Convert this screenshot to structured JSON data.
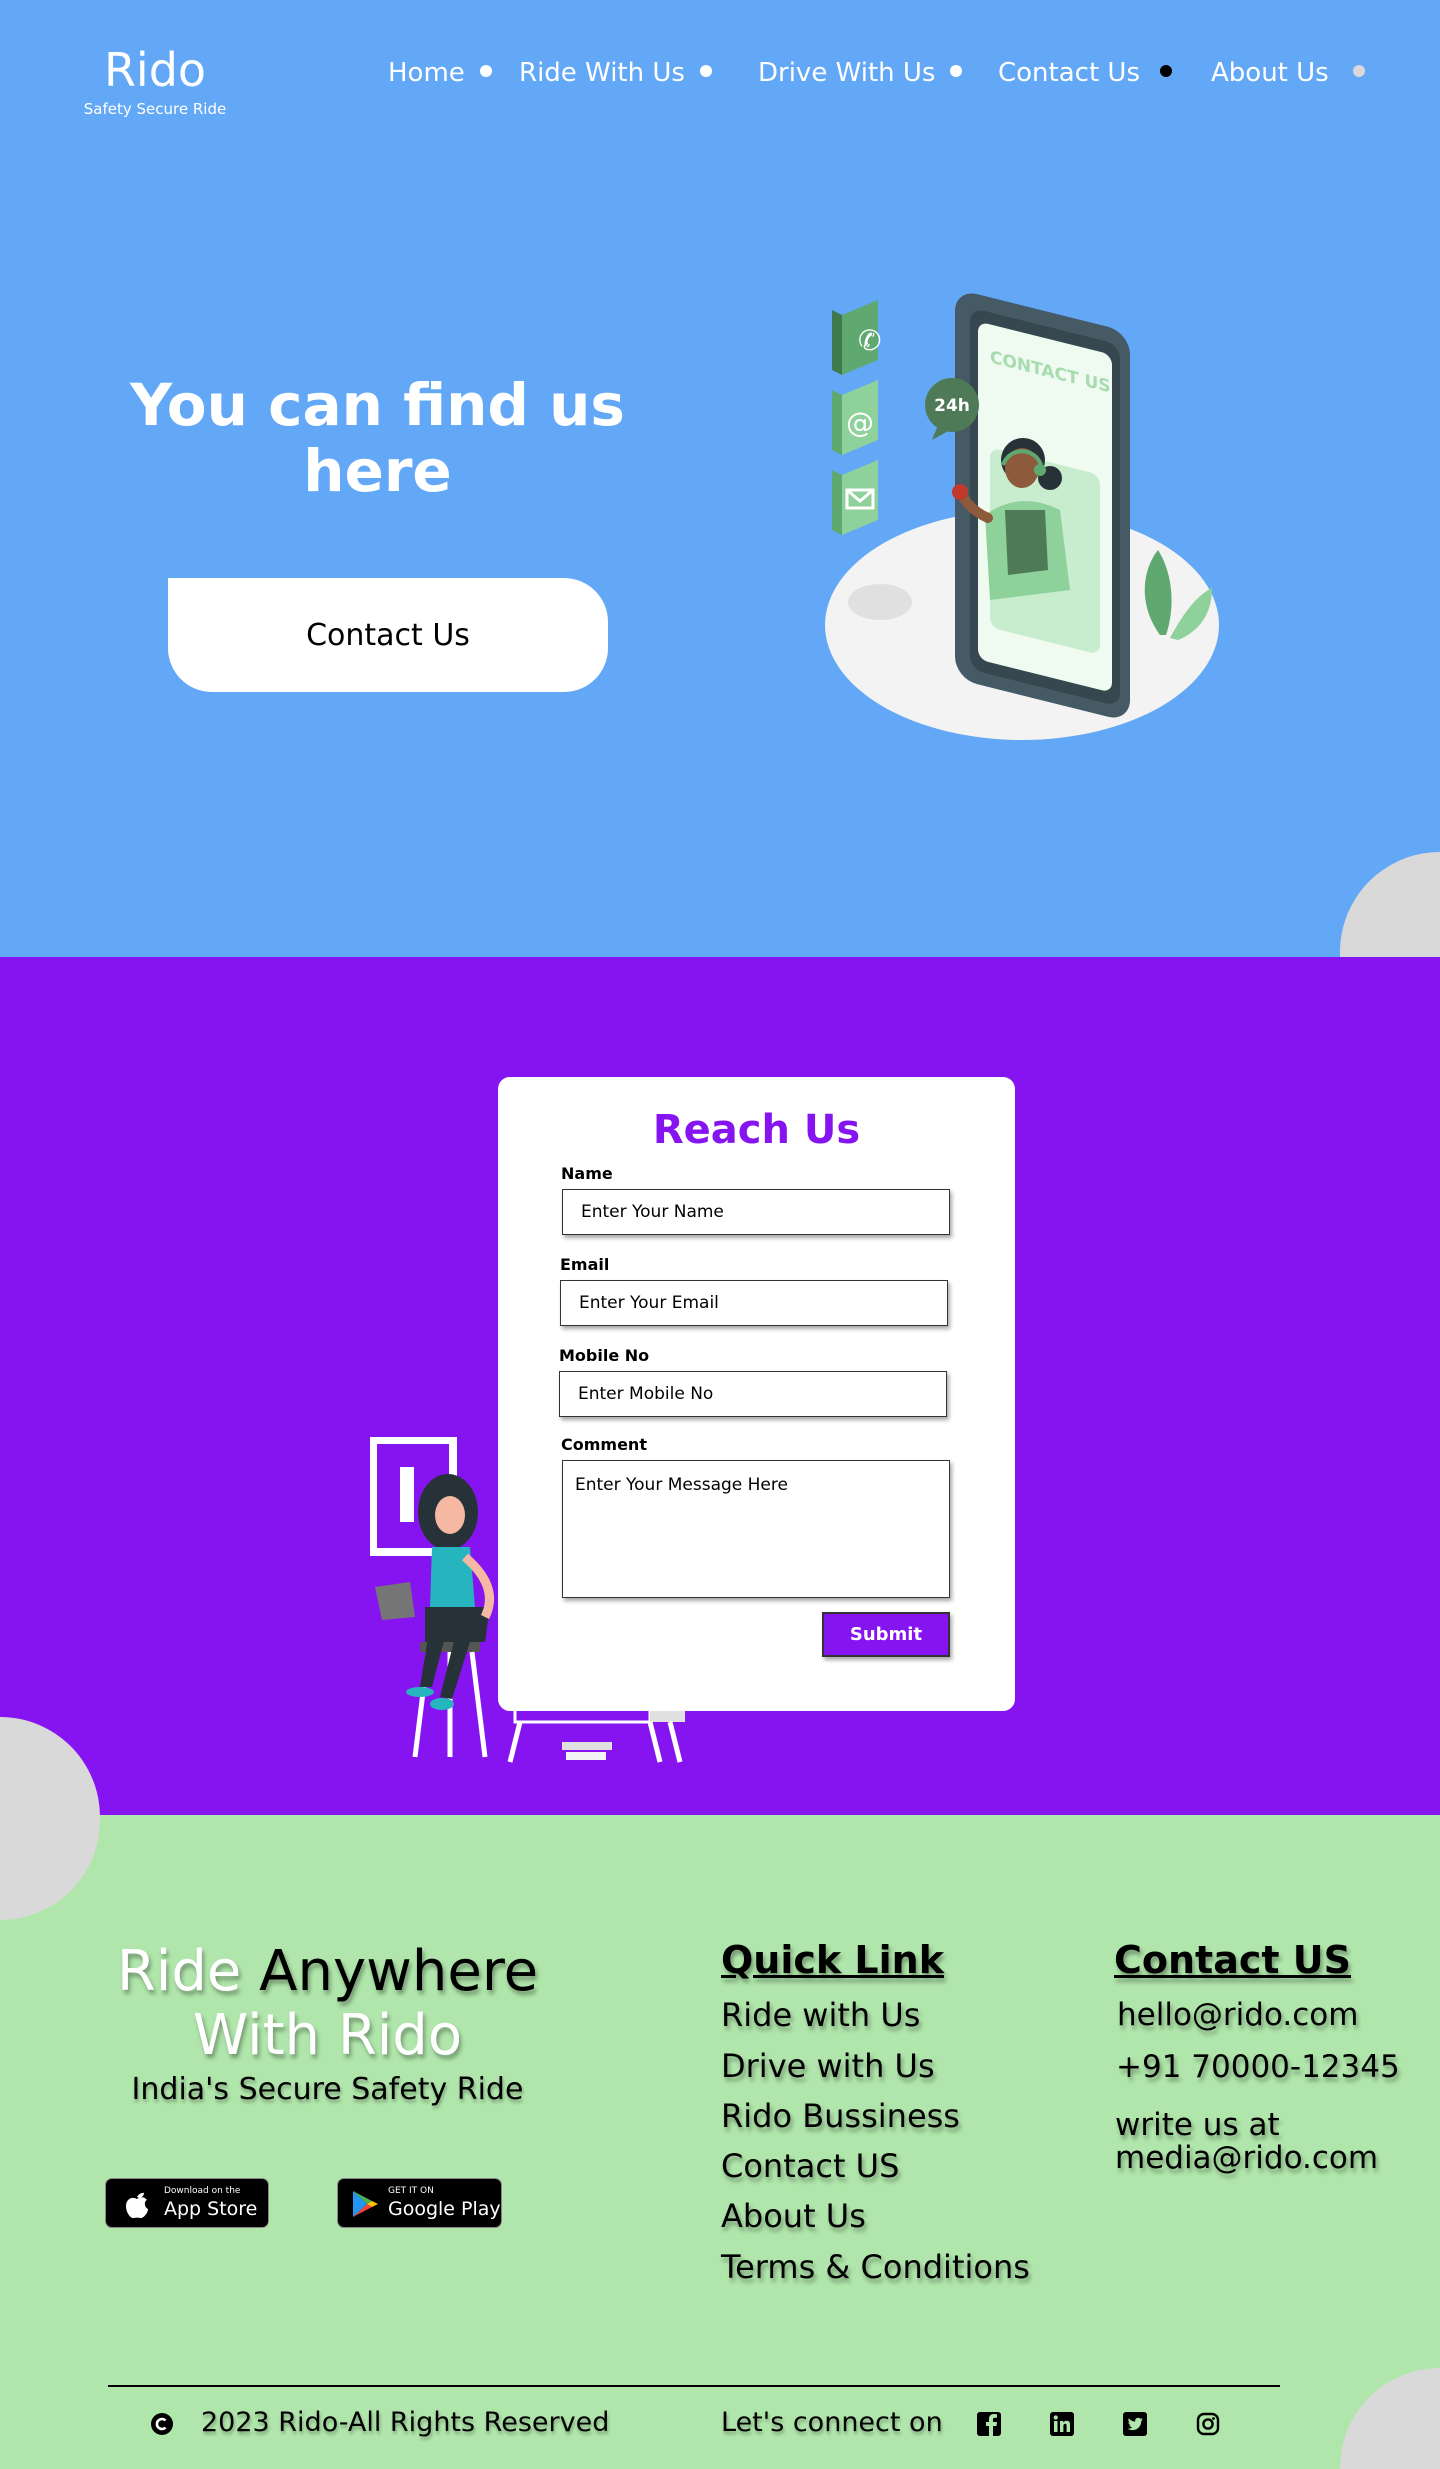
{
  "brand": {
    "name": "Rido",
    "tagline": "Safety Secure Ride"
  },
  "nav": {
    "items": [
      {
        "label": "Home"
      },
      {
        "label": "Ride With Us"
      },
      {
        "label": "Drive With Us"
      },
      {
        "label": "Contact Us",
        "active": true
      },
      {
        "label": "About Us"
      }
    ]
  },
  "hero": {
    "title": "You can find us here",
    "button_label": "Contact Us",
    "illustration": {
      "screen_text": "CONTACT US",
      "badge": "24h",
      "icons": [
        "phone-icon",
        "at-icon",
        "mail-icon"
      ]
    }
  },
  "form": {
    "title": "Reach Us",
    "fields": {
      "name": {
        "label": "Name",
        "placeholder": "Enter Your Name"
      },
      "email": {
        "label": "Email",
        "placeholder": "Enter Your Email"
      },
      "mobile": {
        "label": "Mobile No",
        "placeholder": "Enter Mobile No"
      },
      "comment": {
        "label": "Comment",
        "placeholder": "Enter Your Message Here"
      }
    },
    "submit_label": "Submit"
  },
  "footer": {
    "tagline": {
      "part1": "Ride",
      "part2": "Anywhere",
      "part3": "With Rido"
    },
    "subtitle": "India's Secure Safety Ride",
    "app_store": {
      "small": "Download on the",
      "big": "App Store"
    },
    "google_play": {
      "small": "GET IT ON",
      "big": "Google Play"
    },
    "quick_links": {
      "heading": "Quick Link",
      "items": [
        "Ride with Us",
        "Drive with Us",
        "Rido Bussiness",
        "Contact US",
        "About Us",
        "Terms & Conditions"
      ]
    },
    "contact": {
      "heading": "Contact US",
      "email": "hello@rido.com",
      "phone": "+91 70000-12345",
      "write_line1": "write us at",
      "write_line2": "media@rido.com"
    },
    "copyright": "2023 Rido-All Rights Reserved",
    "connect": "Let's connect on",
    "social": [
      "facebook-icon",
      "linkedin-icon",
      "twitter-icon",
      "instagram-icon"
    ]
  },
  "colors": {
    "hero_bg": "#63a8f6",
    "form_bg": "#8614f0",
    "footer_bg": "#b0e6ab",
    "accent": "#8614f0",
    "circle": "#d9d9d9"
  }
}
